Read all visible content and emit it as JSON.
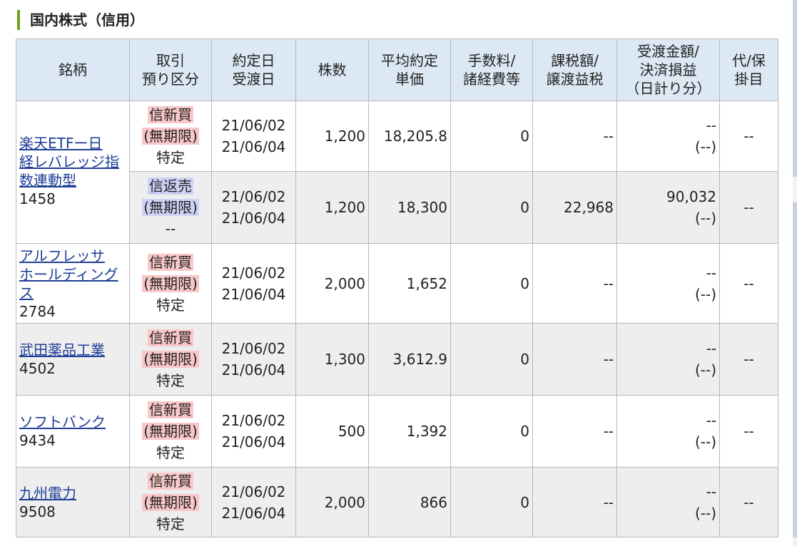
{
  "section_title": "国内株式（信用）",
  "headers": {
    "name": "銘柄",
    "type_l1": "取引",
    "type_l2": "預り区分",
    "date_l1": "約定日",
    "date_l2": "受渡日",
    "qty": "株数",
    "price_l1": "平均約定",
    "price_l2": "単価",
    "fee_l1": "手数料/",
    "fee_l2": "諸経費等",
    "tax_l1": "課税額/",
    "tax_l2": "譲渡益税",
    "amt_l1": "受渡金額/",
    "amt_l2": "決済損益",
    "amt_l3": "（日計り分）",
    "opt_l1": "代/保",
    "opt_l2": "掛目"
  },
  "stocks": [
    {
      "name_l1": "楽天ETFー日",
      "name_l2": "経レバレッジ指",
      "name_l3": "数連動型",
      "code": "1458",
      "trades": [
        {
          "trade": "信新買",
          "period": "(無期限)",
          "account": "特定",
          "trade_date": "21/06/02",
          "settle_date": "21/06/04",
          "qty": "1,200",
          "price": "18,205.8",
          "fee": "0",
          "tax": "--",
          "amount": "--",
          "daily": "(--)",
          "margin": "--"
        },
        {
          "trade": "信返売",
          "period": "(無期限)",
          "account": "--",
          "trade_date": "21/06/02",
          "settle_date": "21/06/04",
          "qty": "1,200",
          "price": "18,300",
          "fee": "0",
          "tax": "22,968",
          "amount": "90,032",
          "daily": "(--)",
          "margin": "--"
        }
      ]
    },
    {
      "name_l1": "アルフレッサ",
      "name_l2": "ホールディング",
      "name_l3": "ス",
      "code": "2784",
      "trade": {
        "trade": "信新買",
        "period": "(無期限)",
        "account": "特定",
        "trade_date": "21/06/02",
        "settle_date": "21/06/04",
        "qty": "2,000",
        "price": "1,652",
        "fee": "0",
        "tax": "--",
        "amount": "--",
        "daily": "(--)",
        "margin": "--"
      }
    },
    {
      "name_l1": "武田薬品工業",
      "code": "4502",
      "trade": {
        "trade": "信新買",
        "period": "(無期限)",
        "account": "特定",
        "trade_date": "21/06/02",
        "settle_date": "21/06/04",
        "qty": "1,300",
        "price": "3,612.9",
        "fee": "0",
        "tax": "--",
        "amount": "--",
        "daily": "(--)",
        "margin": "--"
      }
    },
    {
      "name_l1": "ソフトバンク",
      "code": "9434",
      "trade": {
        "trade": "信新買",
        "period": "(無期限)",
        "account": "特定",
        "trade_date": "21/06/02",
        "settle_date": "21/06/04",
        "qty": "500",
        "price": "1,392",
        "fee": "0",
        "tax": "--",
        "amount": "--",
        "daily": "(--)",
        "margin": "--"
      }
    },
    {
      "name_l1": "九州電力",
      "code": "9508",
      "trade": {
        "trade": "信新買",
        "period": "(無期限)",
        "account": "特定",
        "trade_date": "21/06/02",
        "settle_date": "21/06/04",
        "qty": "2,000",
        "price": "866",
        "fee": "0",
        "tax": "--",
        "amount": "--",
        "daily": "(--)",
        "margin": "--"
      }
    }
  ]
}
